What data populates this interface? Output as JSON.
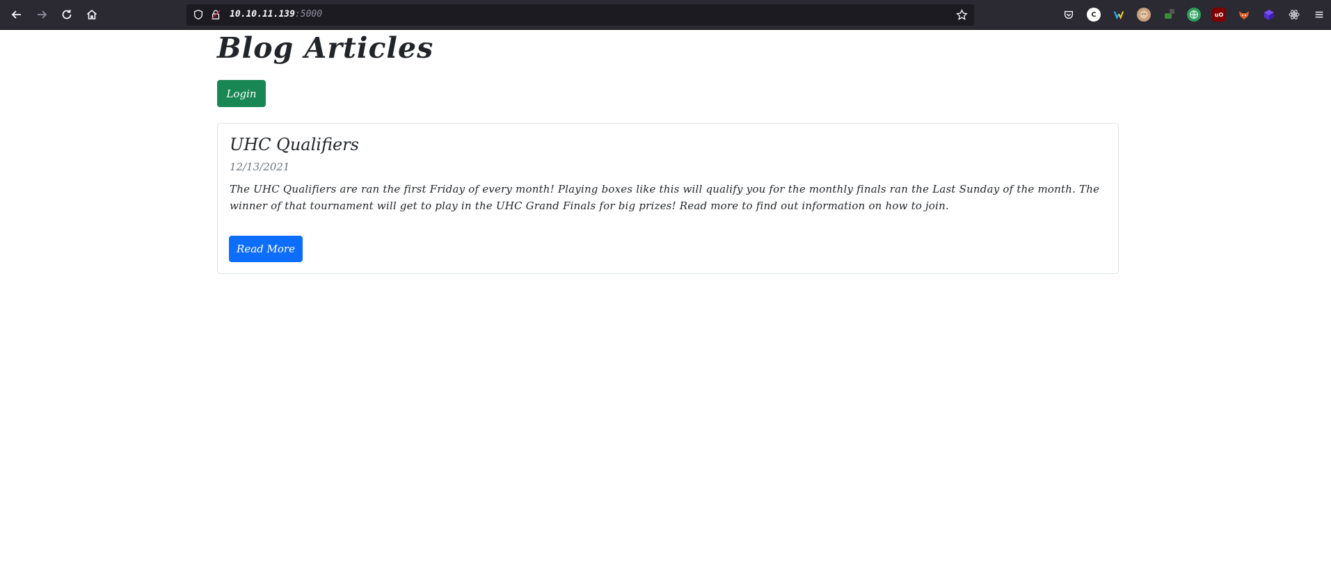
{
  "browser": {
    "url_host": "10.10.11.139",
    "url_port": ":5000",
    "extensions": [
      {
        "name": "pocket",
        "color": "#2b2a33"
      },
      {
        "name": "c-extension",
        "color": "#ffffff"
      },
      {
        "name": "wappalyzer",
        "color": "#2b2a33"
      },
      {
        "name": "avatar-extension",
        "color": "#c9a27e"
      },
      {
        "name": "hack-tools",
        "color": "#3a8a3a"
      },
      {
        "name": "globe-extension",
        "color": "#2f9e5e"
      },
      {
        "name": "ublock-origin",
        "color": "#800000"
      },
      {
        "name": "fox-extension",
        "color": "#e0602a"
      },
      {
        "name": "purple-extension",
        "color": "#5b2fd6"
      },
      {
        "name": "react-devtools",
        "color": "#61dafb"
      }
    ]
  },
  "page": {
    "title": "Blog Articles",
    "login_label": "Login",
    "article": {
      "title": "UHC Qualifiers",
      "date": "12/13/2021",
      "body": "The UHC Qualifiers are ran the first Friday of every month! Playing boxes like this will qualify you for the monthly finals ran the Last Sunday of the month. The winner of that tournament will get to play in the UHC Grand Finals for big prizes! Read more to find out information on how to join.",
      "read_more_label": "Read More"
    }
  },
  "colors": {
    "login_button": "#198754",
    "read_more_button": "#0d6efd",
    "date_text": "#6c757d"
  }
}
